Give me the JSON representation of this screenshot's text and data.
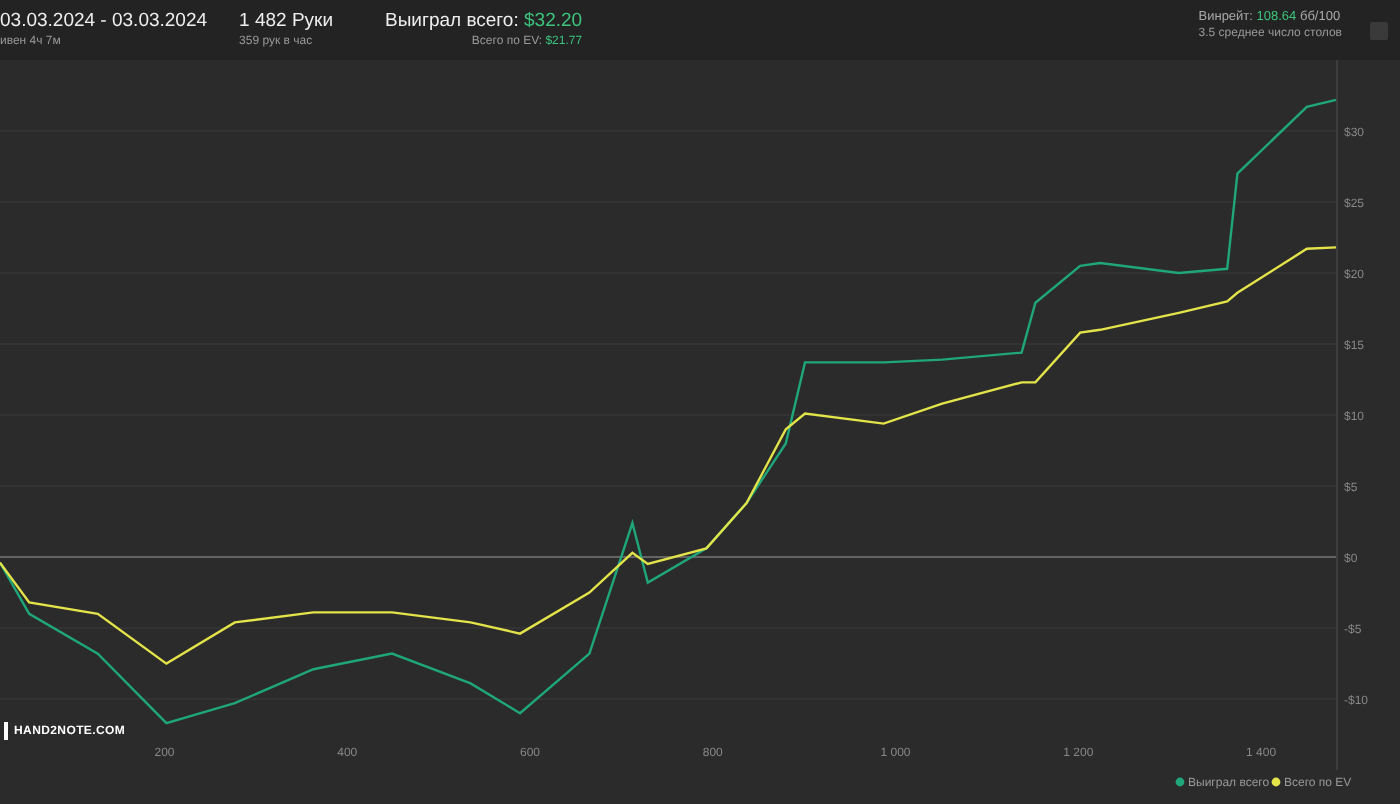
{
  "header": {
    "date_range": "03.03.2024 - 03.03.2024",
    "duration": "ивен 4ч 7м",
    "hands": "1 482 Руки",
    "hands_per_hour": "359 рук в час",
    "won_label": "Выиграл всего:",
    "won_value": "$32.20",
    "ev_label": "Всего по EV:",
    "ev_value": "$21.77",
    "winrate_label": "Винрейт:",
    "winrate_value": "108.64",
    "winrate_unit": "бб/100",
    "tables": "3.5 среднее число столов"
  },
  "chart": {
    "logo": "HAND2NOTE.COM",
    "chart_data": {
      "type": "line",
      "x": [
        20,
        52,
        127,
        202,
        277,
        363,
        449,
        535,
        589,
        665,
        712,
        729,
        793,
        837,
        880,
        901,
        987,
        1051,
        1138,
        1153,
        1202,
        1224,
        1310,
        1363,
        1374,
        1450,
        1482
      ],
      "series": [
        {
          "name": "Выиграл всего",
          "color": "#1fa67a",
          "values": [
            -0.4,
            -4,
            -6.8,
            -11.7,
            -10.3,
            -7.9,
            -6.8,
            -8.9,
            -11,
            -6.8,
            2.4,
            -1.8,
            0.6,
            3.8,
            8,
            13.7,
            13.7,
            13.9,
            14.4,
            17.9,
            20.5,
            20.7,
            20,
            20.3,
            27,
            31.7,
            32.2
          ]
        },
        {
          "name": "Всего по EV",
          "color": "#e3e34a",
          "values": [
            -0.4,
            -3.2,
            -4,
            -7.5,
            -4.6,
            -3.9,
            -3.9,
            -4.6,
            -5.4,
            -2.5,
            0.3,
            -0.5,
            0.6,
            3.8,
            9,
            10.1,
            9.4,
            10.8,
            12.3,
            12.3,
            15.8,
            16,
            17.2,
            18,
            18.6,
            21.7,
            21.8
          ]
        }
      ],
      "grid": true,
      "xlim": [
        20,
        1482
      ],
      "ylim": [
        -15,
        35
      ],
      "legend": true,
      "xticks": [
        200,
        400,
        600,
        800,
        {
          "value": 1000,
          "label": "1 000"
        },
        {
          "value": 1200,
          "label": "1 200"
        },
        {
          "value": 1400,
          "label": "1 400"
        }
      ],
      "yticks": [
        {
          "value": 30,
          "label": "$30"
        },
        {
          "value": 25,
          "label": "$25"
        },
        {
          "value": 20,
          "label": "$20"
        },
        {
          "value": 15,
          "label": "$15"
        },
        {
          "value": 10,
          "label": "$10"
        },
        {
          "value": 5,
          "label": "$5"
        },
        {
          "value": 0,
          "label": "$0"
        },
        {
          "value": -5,
          "label": "-$5"
        },
        {
          "value": -10,
          "label": "-$10"
        }
      ]
    }
  }
}
